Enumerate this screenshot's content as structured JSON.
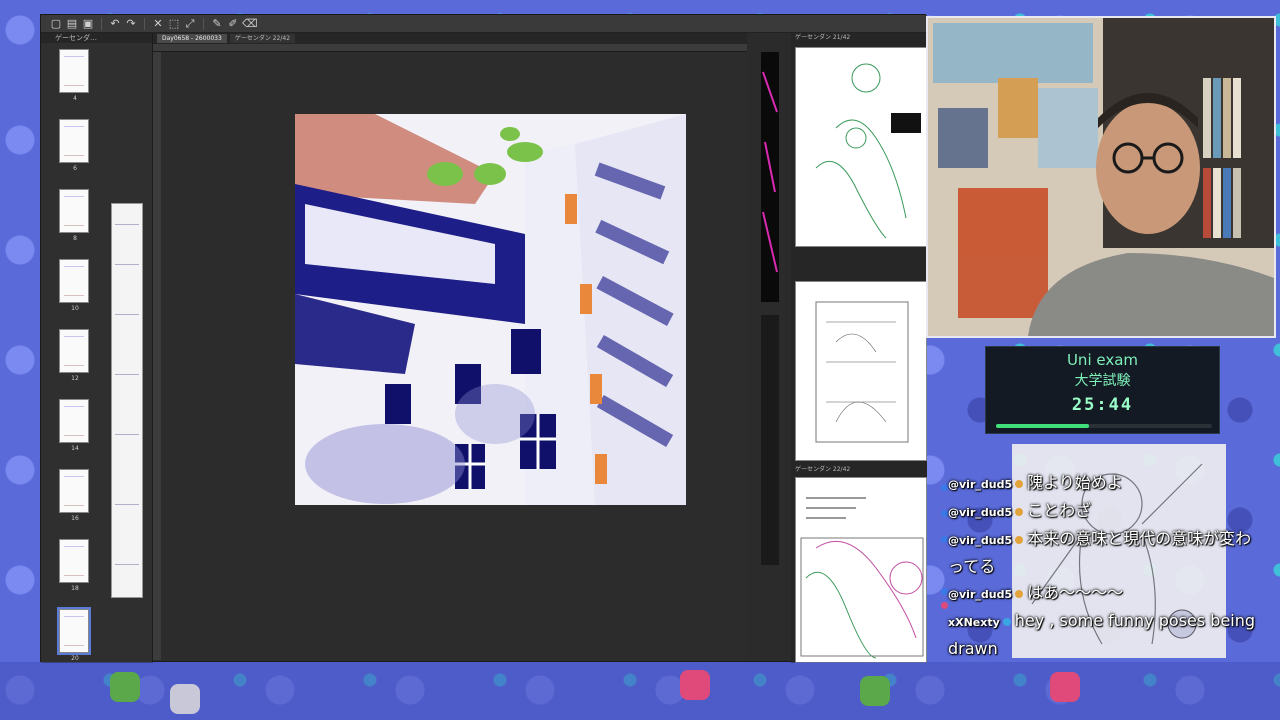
{
  "app": {
    "panel_tab": "ゲーセンダ…",
    "side_tab": "21/42",
    "tabs": [
      {
        "label": "Day0658 - 2600033",
        "active": true
      },
      {
        "label": "ゲーセンダン 22/42",
        "active": false
      }
    ],
    "right_tab_top": "ゲーセンダン 21/42",
    "right_tab_bottom": "ゲーセンダン 22/42",
    "thumbnails": [
      {
        "num": "4",
        "selected": false
      },
      {
        "num": "6",
        "selected": false
      },
      {
        "num": "8",
        "selected": false
      },
      {
        "num": "10",
        "selected": false
      },
      {
        "num": "12",
        "selected": false
      },
      {
        "num": "14",
        "selected": false
      },
      {
        "num": "16",
        "selected": false
      },
      {
        "num": "18",
        "selected": false
      },
      {
        "num": "20",
        "selected": true
      }
    ]
  },
  "timer": {
    "title": "Uni exam",
    "subtitle": "大学試験",
    "clock": "25:44",
    "progress": 0.43,
    "color": "#3fe07c"
  },
  "chat": [
    {
      "user": "@vir_dud5",
      "badge": "gold",
      "text": "隗より始めよ"
    },
    {
      "user": "@vir_dud5",
      "badge": "gold",
      "text": "ことわざ"
    },
    {
      "user": "@vir_dud5",
      "badge": "gold",
      "text": "本来の意味と現代の意味が変わってる"
    },
    {
      "user": "@vir_dud5",
      "badge": "gold",
      "text": "はあ〜〜〜〜"
    },
    {
      "user": "xXNexty",
      "badge": "blue",
      "text": "hey , some funny poses being drawn"
    }
  ],
  "colors": {
    "background": "#5a6ad8",
    "accent": "#3fe07c"
  }
}
